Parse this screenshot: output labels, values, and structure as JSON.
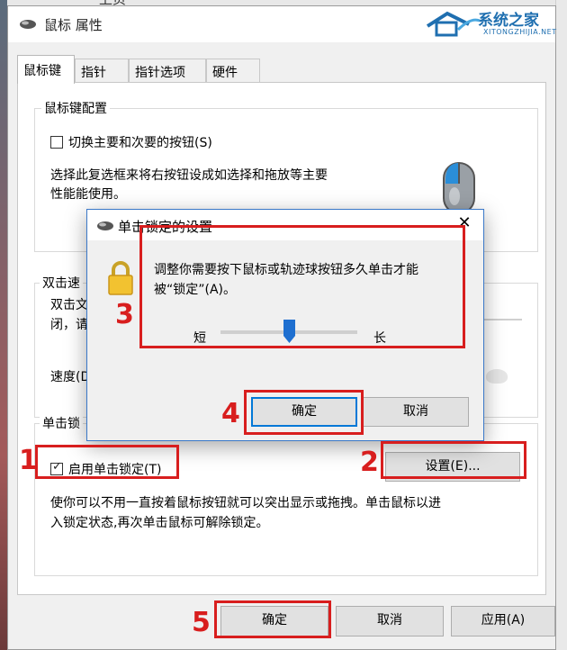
{
  "window": {
    "title": "鼠标 属性",
    "background_title_fragment": "上页"
  },
  "watermark": {
    "text": "系统之家",
    "subtext": "XITONGZHIJIA.NET"
  },
  "tabs": [
    {
      "label": "鼠标键",
      "active": true
    },
    {
      "label": "指针",
      "active": false
    },
    {
      "label": "指针选项",
      "active": false
    },
    {
      "label": "硬件",
      "active": false
    }
  ],
  "button_config": {
    "group_title": "鼠标键配置",
    "switch_checkbox_label": "切换主要和次要的按钮(S)",
    "switch_checked": false,
    "description": [
      "选择此复选框来将右按钮设成如选择和拖放等主要",
      "性能能使用。"
    ]
  },
  "double_click": {
    "group_title_visible": "双击速",
    "desc_line1": "双击文",
    "desc_line2": "闭，请",
    "speed_label": "速度(D"
  },
  "click_lock": {
    "group_title_visible": "单击锁",
    "enable_checkbox_label": "启用单击锁定(T)",
    "enabled": true,
    "settings_button": "设置(E)...",
    "description": [
      "使你可以不用一直按着鼠标按钮就可以突出显示或拖拽。单击鼠标以进",
      "入锁定状态,再次单击鼠标可解除锁定。"
    ]
  },
  "dialog": {
    "title": "单击锁定的设置",
    "close_glyph": "✕",
    "instruction": [
      "调整你需要按下鼠标或轨迹球按钮多久单击才能",
      "被“锁定”(A)。"
    ],
    "slider_short": "短",
    "slider_long": "长",
    "slider_value": 0.5,
    "ok": "确定",
    "cancel": "取消"
  },
  "footer": {
    "ok": "确定",
    "cancel": "取消",
    "apply": "应用(A)"
  },
  "annotations": [
    "1",
    "2",
    "3",
    "4",
    "5"
  ],
  "colors": {
    "highlight_red": "#d81e1e",
    "accent_blue": "#0078d7",
    "slider_blue": "#1e6fd0"
  }
}
